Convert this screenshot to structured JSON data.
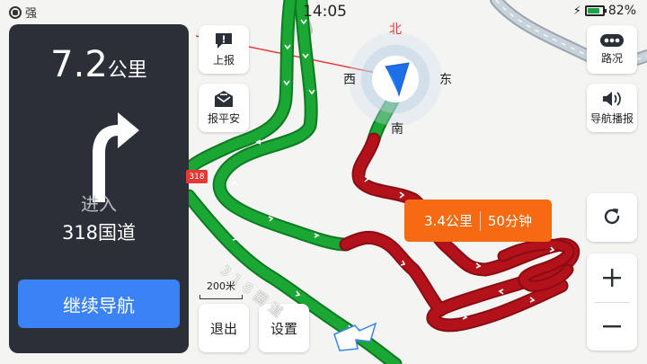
{
  "status_bar": {
    "signal": "强",
    "time": "14:05",
    "battery": "82%",
    "battery_level": 0.82
  },
  "guidance": {
    "distance_value": "7.2",
    "distance_unit": "公里",
    "maneuver": "进入",
    "road_name": "318国道",
    "continue_label": "继续导航"
  },
  "left_buttons": {
    "report": "上报",
    "safe": "报平安",
    "exit": "退出",
    "settings": "设置"
  },
  "right_buttons": {
    "traffic": "路况",
    "broadcast": "导航播报"
  },
  "compass": {
    "north": "北",
    "south": "南",
    "east": "东",
    "west": "西"
  },
  "route_tip": {
    "distance": "3.4公里",
    "time": "50分钟"
  },
  "map": {
    "scale": "200米",
    "road_badge": "318",
    "road_label": "318国道"
  },
  "colors": {
    "panel": "#2b2f38",
    "primary": "#3b82f6",
    "tip": "#f66b12",
    "route_green": "#1aa734",
    "route_red": "#b3121b"
  },
  "icons": {
    "report": "report-icon",
    "safe": "envelope-icon",
    "traffic": "traffic-icon",
    "broadcast": "speaker-icon",
    "refresh": "refresh-icon",
    "zoom_in": "plus-icon",
    "zoom_out": "minus-icon",
    "turn": "turn-right-arrow-icon",
    "position": "navigation-arrow-icon"
  }
}
